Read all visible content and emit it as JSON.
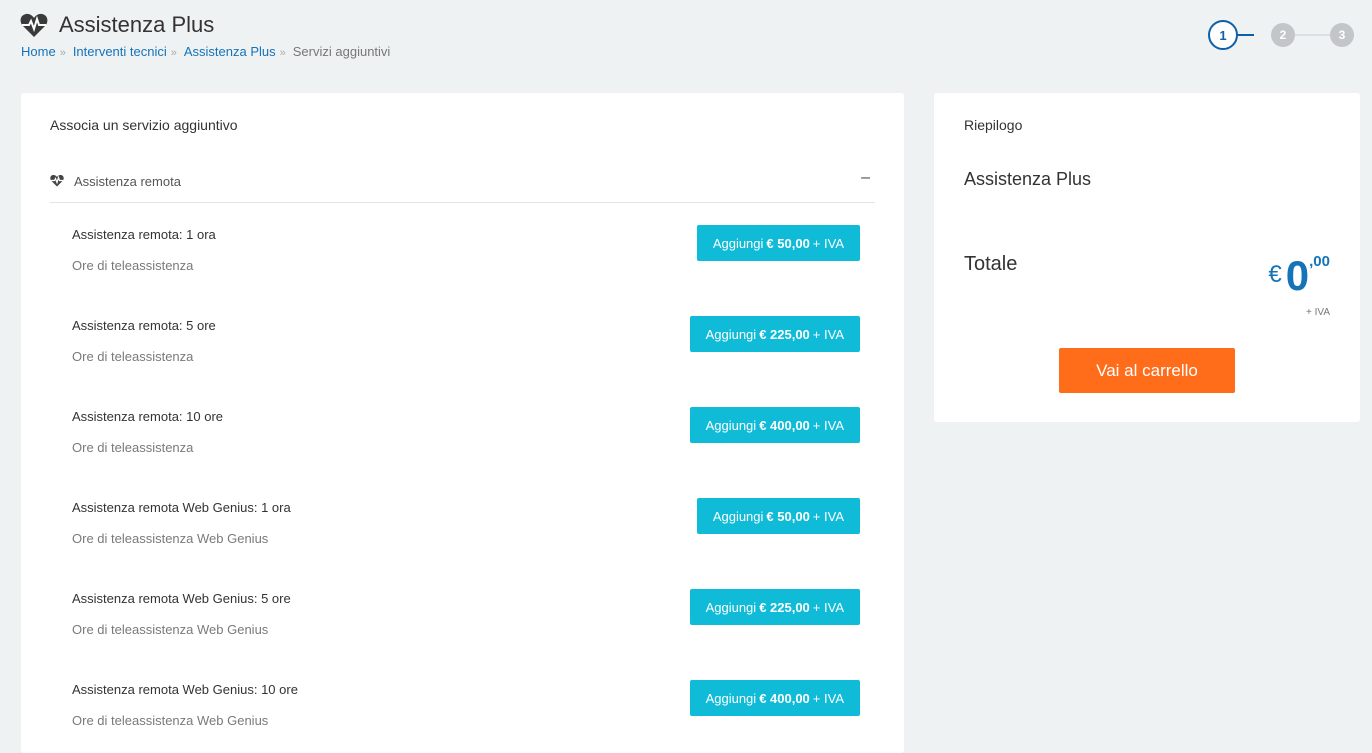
{
  "header": {
    "title": "Assistenza Plus",
    "icon": "heartbeat-icon"
  },
  "breadcrumb": {
    "items": [
      "Home",
      "Interventi tecnici",
      "Assistenza Plus"
    ],
    "current": "Servizi aggiuntivi",
    "separator": "»"
  },
  "stepper": {
    "steps": [
      "1",
      "2",
      "3"
    ],
    "active_step": 1,
    "active_color": "#0f5fa8"
  },
  "main": {
    "title": "Associa un servizio aggiuntivo",
    "section": {
      "label": "Assistenza remota",
      "collapse_symbol": "–"
    },
    "items": [
      {
        "name": "Assistenza remota: 1 ora",
        "desc": "Ore di teleassistenza",
        "btn_prefix": "Aggiungi",
        "price": "€ 50,00",
        "btn_suffix": "+ IVA"
      },
      {
        "name": "Assistenza remota: 5 ore",
        "desc": "Ore di teleassistenza",
        "btn_prefix": "Aggiungi",
        "price": "€ 225,00",
        "btn_suffix": "+ IVA"
      },
      {
        "name": "Assistenza remota: 10 ore",
        "desc": "Ore di teleassistenza",
        "btn_prefix": "Aggiungi",
        "price": "€ 400,00",
        "btn_suffix": "+ IVA"
      },
      {
        "name": "Assistenza remota Web Genius: 1 ora",
        "desc": "Ore di teleassistenza Web Genius",
        "btn_prefix": "Aggiungi",
        "price": "€ 50,00",
        "btn_suffix": "+ IVA"
      },
      {
        "name": "Assistenza remota Web Genius: 5 ore",
        "desc": "Ore di teleassistenza Web Genius",
        "btn_prefix": "Aggiungi",
        "price": "€ 225,00",
        "btn_suffix": "+ IVA"
      },
      {
        "name": "Assistenza remota Web Genius: 10 ore",
        "desc": "Ore di teleassistenza Web Genius",
        "btn_prefix": "Aggiungi",
        "price": "€ 400,00",
        "btn_suffix": "+ IVA"
      }
    ]
  },
  "summary": {
    "title": "Riepilogo",
    "product": "Assistenza Plus",
    "total_label": "Totale",
    "currency": "€",
    "total_int": "0",
    "total_dec": ",00",
    "iva": "+ IVA",
    "cart_button": "Vai al carrello"
  },
  "colors": {
    "add_button": "#0fbbd7",
    "cart_button": "#ff6c1a",
    "price_text": "#1573b8",
    "link": "#1573b8"
  }
}
